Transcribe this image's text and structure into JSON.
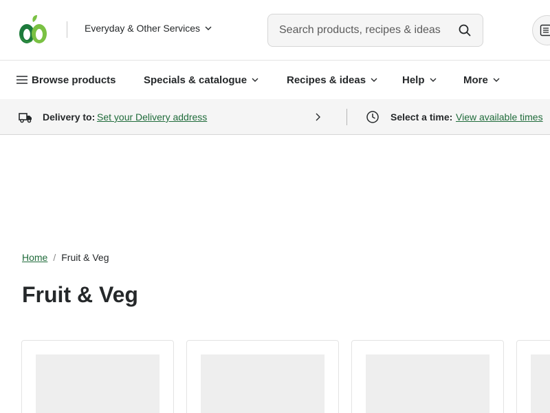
{
  "header": {
    "services_label": "Everyday & Other Services",
    "search_placeholder": "Search products, recipes & ideas",
    "brand_colors": {
      "green_dark": "#1d7a3c",
      "green_light": "#7ac143",
      "accent_green": "#1f6b3a"
    }
  },
  "nav": {
    "items": [
      {
        "label": "Browse products",
        "icon": "hamburger-menu-icon"
      },
      {
        "label": "Specials & catalogue",
        "icon": "chevron-down-icon"
      },
      {
        "label": "Recipes & ideas",
        "icon": "chevron-down-icon"
      },
      {
        "label": "Help",
        "icon": "chevron-down-icon"
      },
      {
        "label": "More",
        "icon": "chevron-down-icon"
      }
    ]
  },
  "delivery": {
    "delivery_label": "Delivery to:",
    "delivery_link": "Set your Delivery address",
    "time_label": "Select a time:",
    "time_link": "View available times"
  },
  "breadcrumb": {
    "home": "Home",
    "separator": "/",
    "current": "Fruit & Veg"
  },
  "page": {
    "title": "Fruit & Veg"
  }
}
